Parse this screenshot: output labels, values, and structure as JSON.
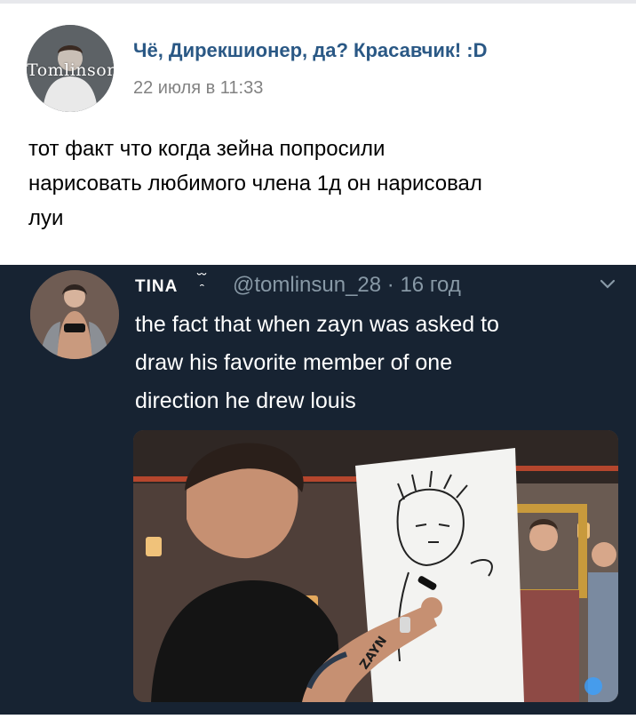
{
  "post": {
    "author": "Чё, Дирекшионер, да? Красавчик! :D",
    "time": "22 июля в 11:33",
    "avatar_overlay": "Tomlinson",
    "text_lines": [
      "тот факт что когда зейна попросили",
      "нарисовать любимого члена 1д он нарисовал",
      "луи"
    ]
  },
  "tweet": {
    "name": "TINA",
    "emoji": "˘̯˘",
    "handle": "@tomlinsun_28 · 16 год",
    "text_lines": [
      "the fact that when zayn was asked to",
      "draw his favorite member of one",
      "direction he drew louis"
    ],
    "image_caption": "ZAYN"
  },
  "colors": {
    "author": "#2a5885",
    "meta": "#828282",
    "tweet_bg": "#172332",
    "tweet_handle": "#8899a6"
  }
}
